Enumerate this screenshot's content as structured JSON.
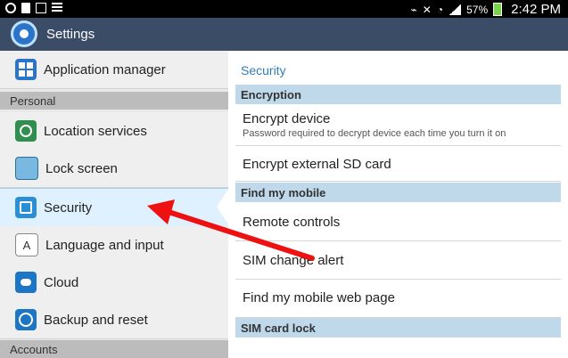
{
  "status_bar": {
    "battery": "57%",
    "time": "2:42 PM",
    "icons_left": [
      "sync-icon",
      "clipboard-icon",
      "gallery-icon",
      "notification-icon"
    ],
    "icons_right": [
      "vibrate-icon",
      "mute-icon",
      "wifi-icon",
      "signal-icon",
      "battery-charging-icon"
    ]
  },
  "title_bar": {
    "title": "Settings",
    "icon": "settings-gear-icon"
  },
  "sidebar": {
    "top_item": {
      "label": "Application manager",
      "icon": "app-grid-icon"
    },
    "section_personal": "Personal",
    "items": [
      {
        "label": "Location services",
        "icon": "location-icon"
      },
      {
        "label": "Lock screen",
        "icon": "lock-screen-icon"
      },
      {
        "label": "Security",
        "icon": "security-lock-icon",
        "selected": true
      },
      {
        "label": "Language and input",
        "icon": "language-icon",
        "glyph": "A"
      },
      {
        "label": "Cloud",
        "icon": "cloud-icon"
      },
      {
        "label": "Backup and reset",
        "icon": "backup-icon"
      }
    ],
    "section_accounts": "Accounts"
  },
  "content": {
    "title": "Security",
    "sections": [
      {
        "header": "Encryption",
        "rows": [
          {
            "label": "Encrypt device",
            "sub": "Password required to decrypt device each time you turn it on"
          },
          {
            "label": "Encrypt external SD card"
          }
        ]
      },
      {
        "header": "Find my mobile",
        "rows": [
          {
            "label": "Remote controls"
          },
          {
            "label": "SIM change alert"
          },
          {
            "label": "Find my mobile web page"
          }
        ]
      },
      {
        "header": "SIM card lock",
        "rows": []
      }
    ]
  },
  "annotation": {
    "type": "red-arrow",
    "color": "#ee1111",
    "points_to": "Security"
  },
  "colors": {
    "title_bar": "#3a4c66",
    "accent": "#2f7fb7",
    "section_bg": "#bfd8ea"
  }
}
